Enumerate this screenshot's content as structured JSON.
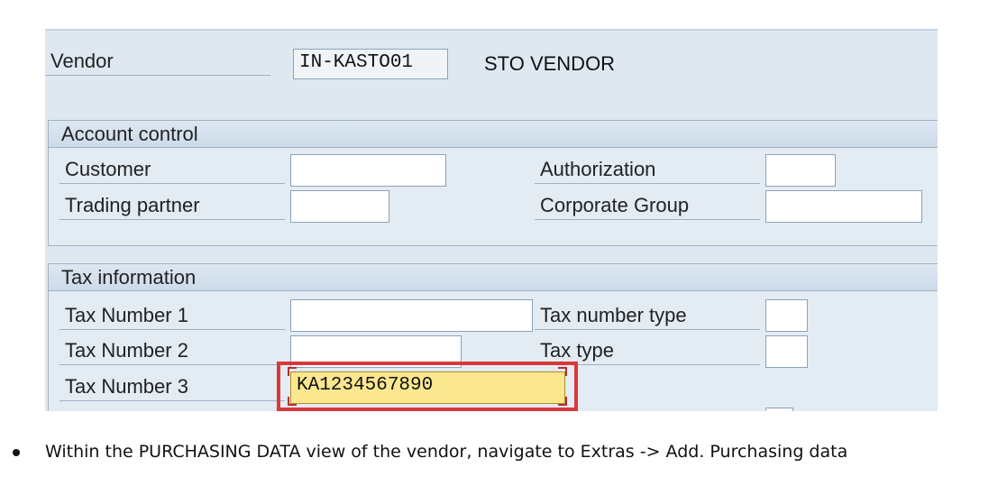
{
  "vendor": {
    "label": "Vendor",
    "number": "IN-KASTO01",
    "name": "STO VENDOR"
  },
  "account_control": {
    "title": "Account control",
    "customer_label": "Customer",
    "customer_value": "",
    "trading_partner_label": "Trading partner",
    "trading_partner_value": "",
    "authorization_label": "Authorization",
    "authorization_value": "",
    "corporate_group_label": "Corporate Group",
    "corporate_group_value": ""
  },
  "tax_information": {
    "title": "Tax information",
    "tax_number_1_label": "Tax Number 1",
    "tax_number_1_value": "",
    "tax_number_2_label": "Tax Number 2",
    "tax_number_2_value": "",
    "tax_number_3_label": "Tax Number 3",
    "tax_number_3_value": "KA1234567890",
    "tax_number_type_label": "Tax number type",
    "tax_number_type_value": "",
    "tax_type_label": "Tax type",
    "tax_type_value": ""
  },
  "instruction": {
    "text": "Within the PURCHASING DATA view of the vendor, navigate to Extras ->  Add. Purchasing data"
  },
  "colors": {
    "highlight_border": "#d9383a",
    "highlighted_field": "#fbe78f",
    "panel_background": "#dfe8f1"
  }
}
